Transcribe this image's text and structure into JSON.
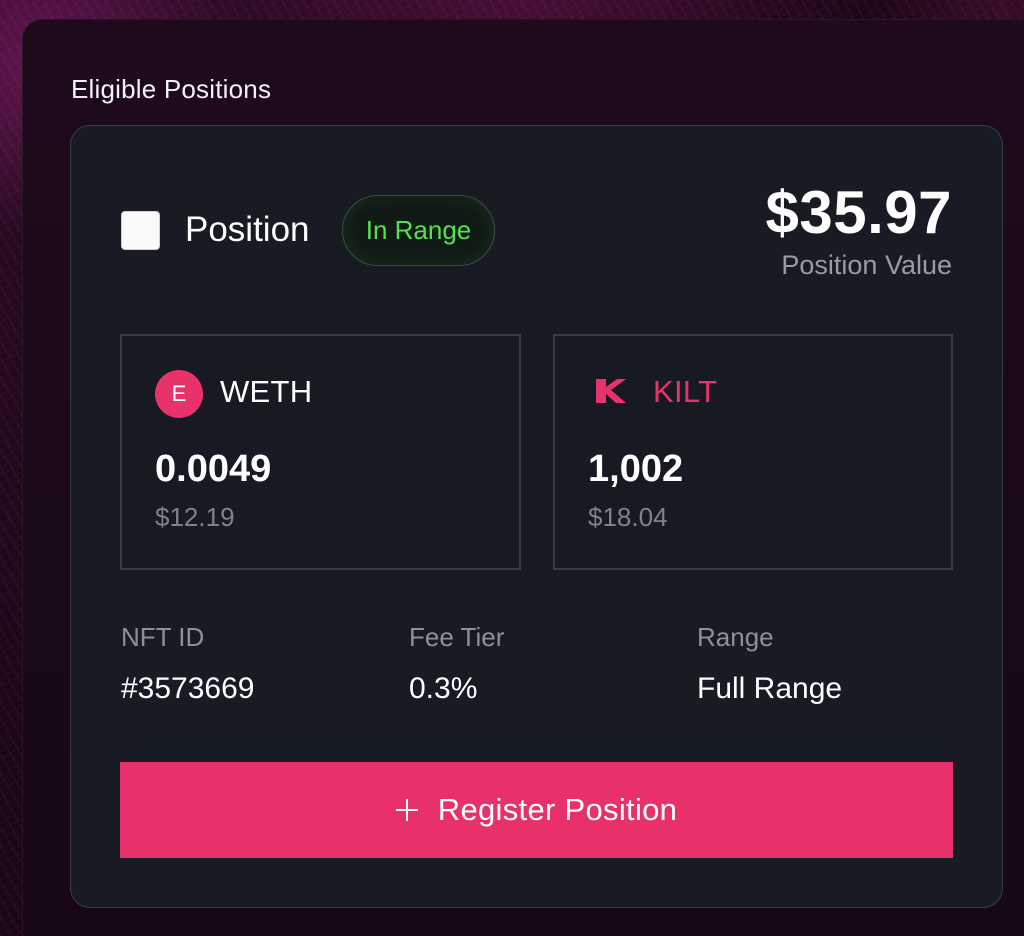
{
  "section": {
    "title": "Eligible Positions"
  },
  "position": {
    "label": "Position",
    "status_badge": "In Range",
    "value_amount": "$35.97",
    "value_label": "Position Value"
  },
  "tokens": [
    {
      "symbol": "WETH",
      "icon": "weth-token-icon",
      "icon_letter": "E",
      "amount": "0.0049",
      "usd": "$12.19",
      "color": "#e8336a"
    },
    {
      "symbol": "KILT",
      "icon": "kilt-token-icon",
      "amount": "1,002",
      "usd": "$18.04",
      "color": "#e8336a"
    }
  ],
  "stats": {
    "nft_id": {
      "label": "NFT ID",
      "value": "#3573669"
    },
    "fee_tier": {
      "label": "Fee Tier",
      "value": "0.3%"
    },
    "range": {
      "label": "Range",
      "value": "Full Range"
    }
  },
  "actions": {
    "register_label": "Register Position",
    "register_icon": "plus-icon"
  },
  "colors": {
    "accent": "#e8306a",
    "in_range": "#53e24f",
    "card_bg": "#181b24"
  }
}
